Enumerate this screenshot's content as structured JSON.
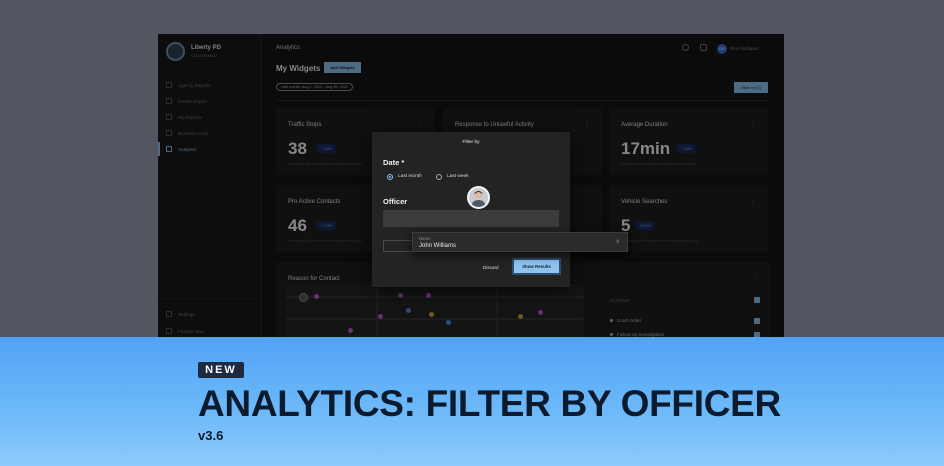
{
  "sidebar": {
    "org_name": "Liberty PD",
    "org_sub": "COLORADO",
    "items": [
      {
        "label": "Agency Reports",
        "active": false
      },
      {
        "label": "Create Report",
        "active": false
      },
      {
        "label": "My Reports",
        "active": false
      },
      {
        "label": "Business Card",
        "active": false
      },
      {
        "label": "Analytics",
        "active": true
      }
    ],
    "bottom_items": [
      {
        "label": "Settings"
      },
      {
        "label": "Feature Tour"
      }
    ]
  },
  "topbar": {
    "section": "Analytics",
    "user_initials": "GR",
    "user_name": "Gina Rodriguez"
  },
  "page": {
    "title": "My Widgets",
    "add_button": "Add Widgets",
    "date_range": "Last month: Aug 1, 2022 - Aug 30, 2022",
    "filter_button": "Filter by (1)"
  },
  "cards": [
    {
      "title": "Traffic Stops",
      "value": "38",
      "badge": "↑ 33%",
      "note": "This was a 33% increase from last month's stops"
    },
    {
      "title": "Response to Unlawful Activity",
      "value": "",
      "badge": "",
      "note": ""
    },
    {
      "title": "Average Duration",
      "value": "17min",
      "badge": "↑ 33%",
      "note": "This was a 33% decrease from last month's stops"
    },
    {
      "title": "Pro Active Contacts",
      "value": "46",
      "badge": "↑ 10%",
      "note": "This was a 10% increase from last month's stops"
    },
    {
      "title": "",
      "value": "",
      "badge": "",
      "note": ""
    },
    {
      "title": "Vehicle Searches",
      "value": "5",
      "badge": "100%",
      "note": "This was a 100% decrease from last month's stops"
    }
  ],
  "reason_card": {
    "title": "Reason for Contact",
    "legend_header": "FILTER BY",
    "legend_items": [
      "Court Order",
      "Follow Up Investigation"
    ]
  },
  "modal": {
    "title": "Filter by",
    "date_label": "Date *",
    "radio_last_month": "Last month",
    "radio_last_week": "Last week",
    "officer_label": "Officer",
    "clear_label": "Clear All",
    "discard_label": "Discard",
    "show_label": "Show Results"
  },
  "officer_dropdown": {
    "label": "Name",
    "value": "John Williams"
  },
  "banner": {
    "badge": "NEW",
    "headline": "ANALYTICS: FILTER BY OFFICER",
    "version": "v3.6"
  },
  "colors": {
    "accent": "#8fc3f0",
    "banner": "#5aa8f7",
    "headline": "#0c1a2e"
  }
}
